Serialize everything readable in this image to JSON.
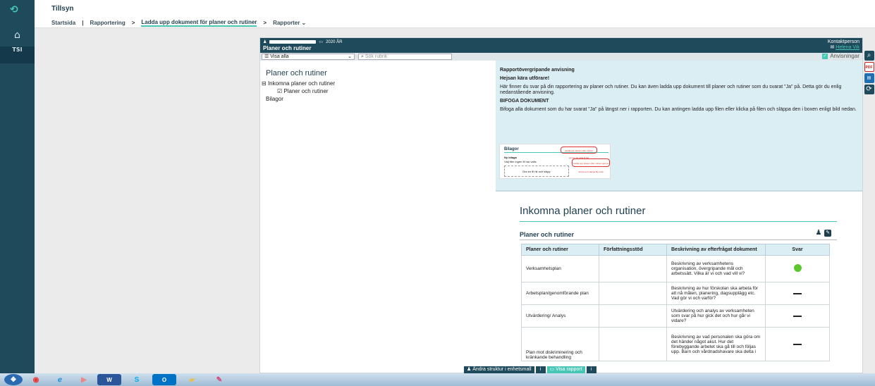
{
  "app": {
    "title": "Tillsyn",
    "logo": "tillsyn-logo",
    "sidebar_ts": "TSI"
  },
  "breadcrumbs": [
    {
      "label": "Startsida",
      "sep": "|"
    },
    {
      "label": "Rapportering",
      "sep": ">"
    },
    {
      "label": "Ladda upp dokument för planer och rutiner",
      "sep": ">"
    },
    {
      "label": "Rapporter ⌄",
      "sep": ""
    }
  ],
  "panel": {
    "year": "2020 ÅR",
    "title": "Planer och rutiner",
    "kontakt_label": "Kontaktperson",
    "kontakt_person": "Helena Vik",
    "visa_alla": "Visa alla",
    "sok_placeholder": "Sök rubrik",
    "anvisningar": "Anvisningar"
  },
  "tree": {
    "title": "Planer och rutiner",
    "items": [
      "Inkomna planer och rutiner",
      "Planer och rutiner",
      "Bilagor"
    ]
  },
  "instructions": {
    "heading": "Rapportövergripande anvisning",
    "greeting": "Hejsan kära utförare!",
    "body1": "Här finner du svar på din rapportering av planer och rutiner. Du kan även ladda upp dokument till planer och rutiner som du svarat \"Ja\" på. Detta gör du enlig nedanstående anvisning.",
    "subheading": "BIFOGA DOKUMENT",
    "body2": "Bifoga alla dokument som du har svarat \"Ja\" på längst ner i rapporten. Du kan antingen ladda upp filen eller klicka på filen och släppa den i boxen enligt bild nedan.",
    "demo": {
      "title": "Bilagor",
      "ny": "Ny bilaga",
      "file": "Välj filer  Ingen fil har valts",
      "drop": "Dra en fil hit och släpp",
      "bubble1": "Ladda upp planen eller rutinen genom att välja fil här",
      "bubble2": "Ladda upp planen eller rutinen genom att dra och släppa filen här"
    }
  },
  "inkomna": {
    "title": "Inkomna planer och rutiner",
    "section": "Planer och rutiner",
    "headers": [
      "Planer och rutiner",
      "Författningsstöd",
      "Beskrivning av efterfrågat dokument",
      "Svar"
    ],
    "rows": [
      {
        "name": "Verksamhetsplan",
        "stod": "",
        "desc": "Beskrivning av verksamhetens organisation, övergripande mål och arbetssätt. Vilka är vi och vad vill vi?",
        "svar": "green"
      },
      {
        "name": "Arbetsplan/genomförande plan",
        "stod": "",
        "desc": "Beskrivning av hur förskolan ska arbeta för att nå målen, planering, dagsupplägg etc. Vad gör vi och varför?",
        "svar": "dash"
      },
      {
        "name": "Utvärdering/ Analys",
        "stod": "",
        "desc": "Utvärdering och analys av verksamheten som svar på hur gick det och hur går vi vidare?",
        "svar": "dash"
      },
      {
        "name": "Plan mot diskriminering och kränkande behandling",
        "stod": "",
        "desc": "Beskrivning av vad personalen ska göra om det händer något akut. Hur det förebyggande arbetet ska gå till och följas upp. Barn och vårdnadshavare ska delta i",
        "svar": "dash"
      }
    ]
  },
  "bottom": {
    "andra": "Ändra struktur i enhetsmall",
    "visa": "Visa rapport",
    "info": "i"
  },
  "taskbar": [
    "start",
    "chrome",
    "ie",
    "media",
    "word",
    "skype",
    "outlook",
    "folder",
    "paint"
  ]
}
